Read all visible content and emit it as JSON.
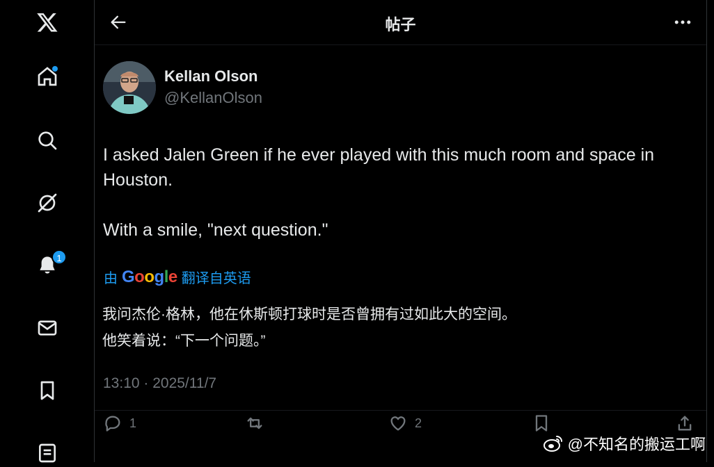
{
  "sidebar": {
    "logo": "x-logo-icon",
    "items": [
      {
        "name": "home",
        "icon": "home-icon",
        "has_dot": true
      },
      {
        "name": "explore",
        "icon": "search-icon"
      },
      {
        "name": "grok",
        "icon": "grok-icon"
      },
      {
        "name": "notifications",
        "icon": "bell-icon",
        "badge": "1"
      },
      {
        "name": "messages",
        "icon": "mail-icon"
      },
      {
        "name": "bookmarks",
        "icon": "bookmark-icon"
      },
      {
        "name": "lists",
        "icon": "list-icon"
      }
    ]
  },
  "header": {
    "title": "帖子",
    "back_icon": "back-arrow-icon",
    "more_icon": "more-icon"
  },
  "post": {
    "author_name": "Kellan Olson",
    "author_handle": "@KellanOlson",
    "text_line1": "I asked Jalen Green if he ever played with this much room and space in Houston.",
    "text_line2": "With a smile, \"next question.\"",
    "translate": {
      "prefix": "由",
      "provider": "Google",
      "suffix": "翻译自英语"
    },
    "translated_line1": "我问杰伦·格林，他在休斯顿打球时是否曾拥有过如此大的空间。",
    "translated_line2": "他笑着说：“下一个问题。”",
    "timestamp": "13:10 · 2025/11/7",
    "actions": {
      "reply_count": "1",
      "repost_count": "",
      "like_count": "2"
    }
  },
  "watermark": {
    "text": "@不知名的搬运工啊"
  },
  "colors": {
    "accent": "#1d9bf0",
    "background": "#000000",
    "text": "#e7e9ea",
    "muted": "#71767b"
  }
}
